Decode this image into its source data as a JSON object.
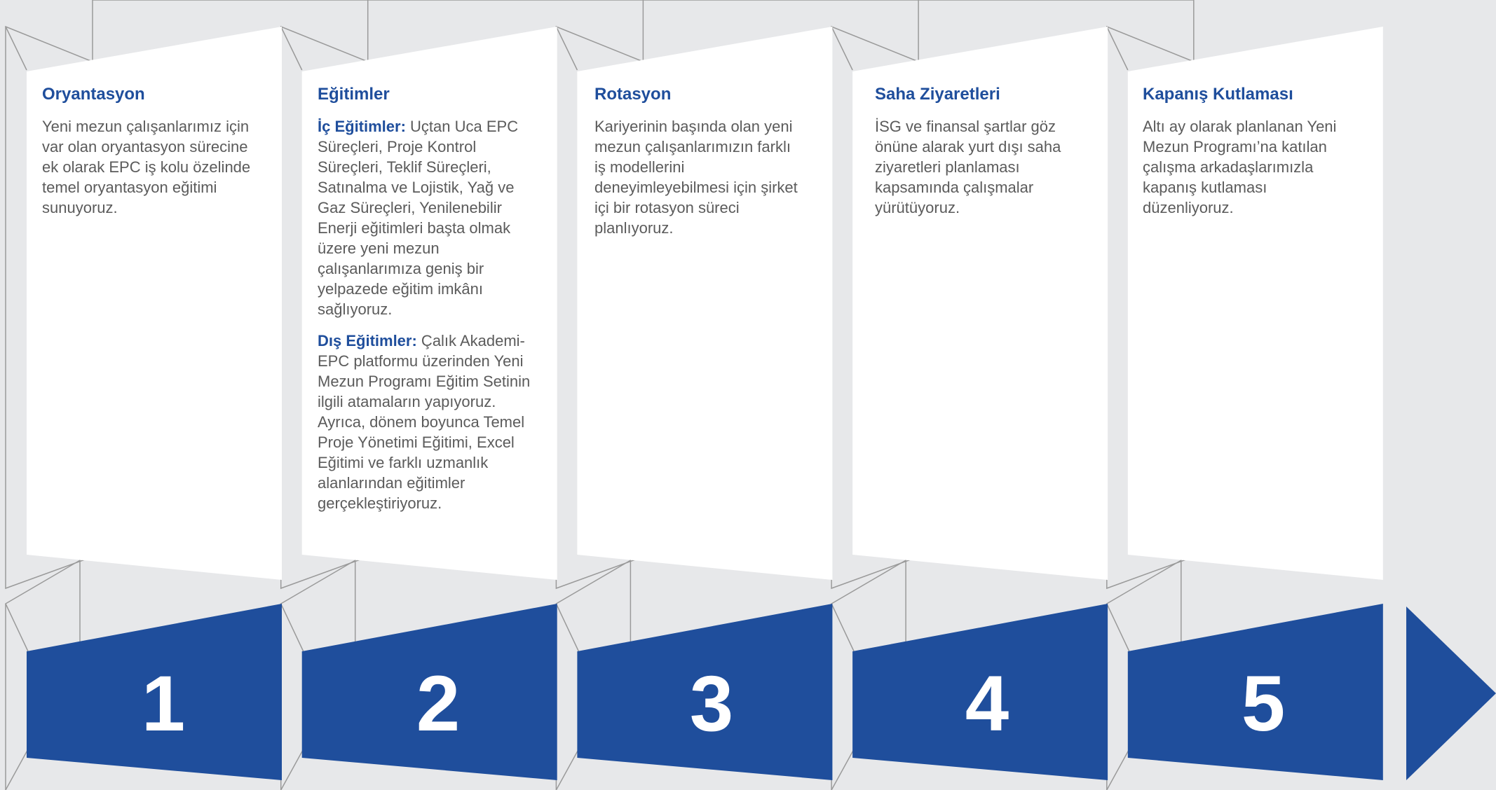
{
  "steps": [
    {
      "number": "1",
      "title": "Oryantasyon",
      "paragraphs": [
        {
          "head": "",
          "text": "Yeni mezun çalışanlarımız için var olan oryantasyon sürecine ek olarak EPC iş kolu özelinde temel oryantasyon eğitimi sunuyoruz."
        }
      ]
    },
    {
      "number": "2",
      "title": "Eğitimler",
      "paragraphs": [
        {
          "head": "İç Eğitimler:",
          "text": " Uçtan Uca EPC Süreçleri, Proje Kontrol Süreçleri, Teklif Süreçleri, Satınalma ve Lojistik, Yağ ve Gaz Süreçleri, Yenilenebilir Enerji eğitimleri başta olmak üzere yeni mezun çalışanlarımıza geniş bir yelpazede eğitim imkânı sağlıyoruz."
        },
        {
          "head": "Dış Eğitimler:",
          "text": " Çalık Akademi-EPC platformu üzerinden Yeni Mezun Programı Eğitim Setinin ilgili atamaların yapıyoruz. Ayrıca, dönem boyunca Temel Proje Yönetimi Eğitimi, Excel Eğitimi ve farklı uzmanlık alanlarından eğitimler gerçekleştiriyoruz."
        }
      ]
    },
    {
      "number": "3",
      "title": "Rotasyon",
      "paragraphs": [
        {
          "head": "",
          "text": "Kariyerinin başında olan yeni mezun çalışanlarımızın farklı iş modellerini deneyimleyebilmesi için şirket içi bir rotasyon süreci planlıyoruz."
        }
      ]
    },
    {
      "number": "4",
      "title": "Saha Ziyaretleri",
      "paragraphs": [
        {
          "head": "",
          "text": "İSG ve finansal şartlar göz önüne alarak yurt dışı saha ziyaretleri planlaması kapsamında çalışmalar yürütüyoruz."
        }
      ]
    },
    {
      "number": "5",
      "title": "Kapanış Kutlaması",
      "paragraphs": [
        {
          "head": "",
          "text": "Altı ay olarak planlanan Yeni Mezun Programı’na katılan çalışma arkadaşlarımızla kapanış kutlaması düzenliyoruz."
        }
      ]
    }
  ],
  "colors": {
    "accent": "#1f4e9c",
    "background": "#e7e8ea",
    "card": "#ffffff",
    "outline": "#9a9a9a",
    "body_text": "#5b5b5b"
  }
}
